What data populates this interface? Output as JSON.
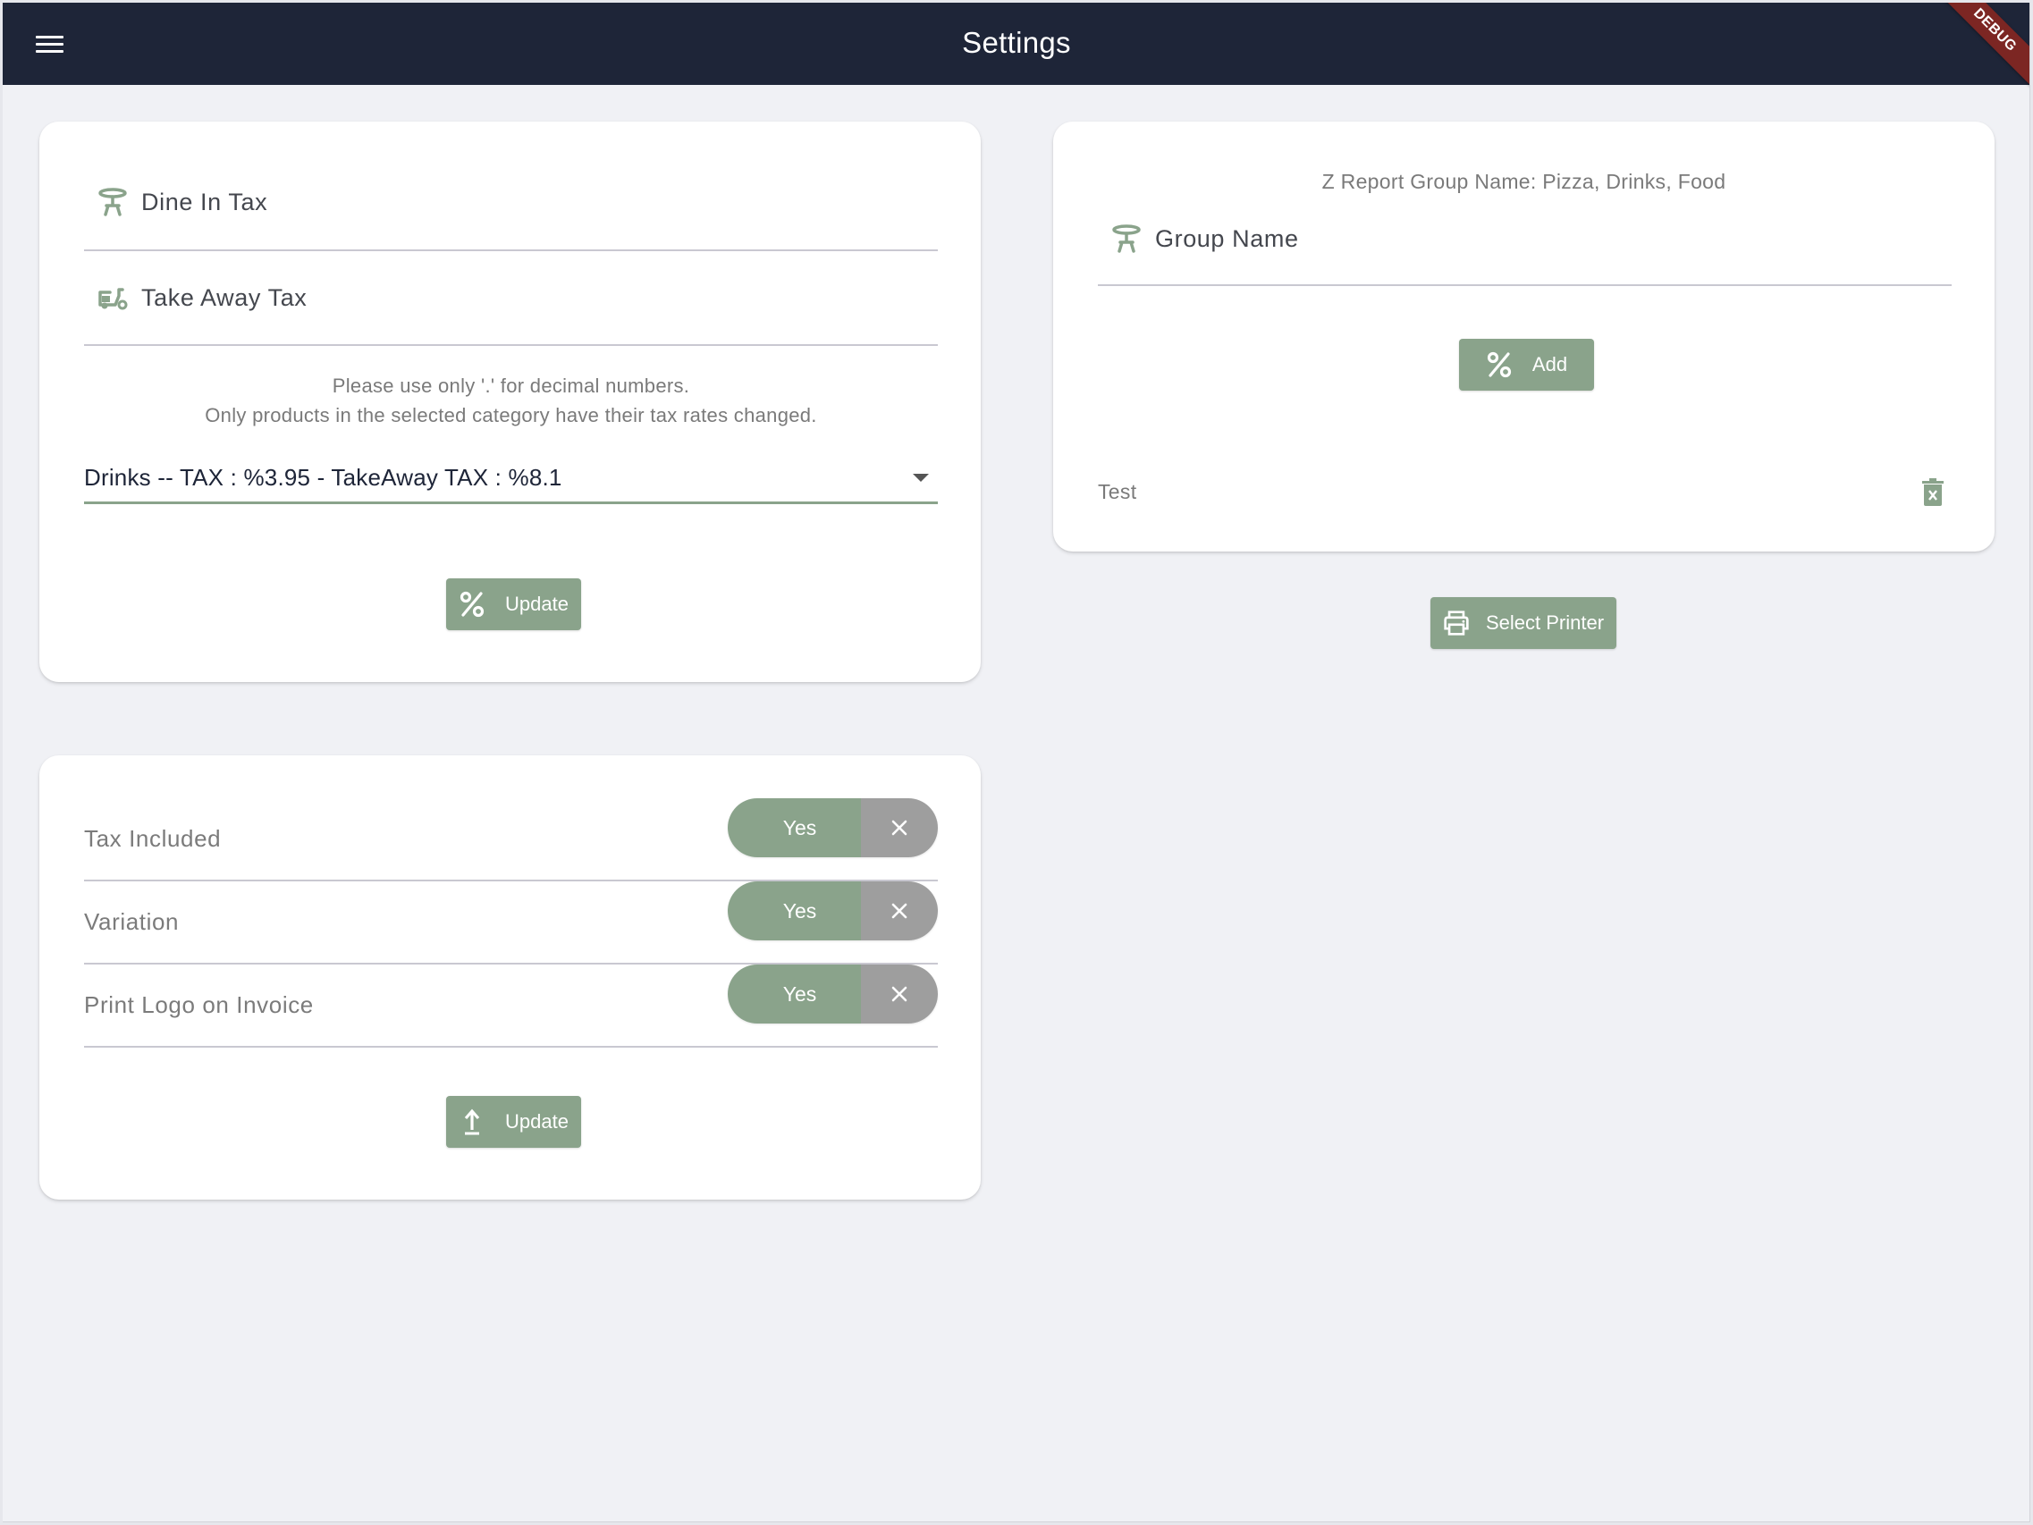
{
  "appbar": {
    "title": "Settings",
    "menu_icon": "hamburger-menu-icon",
    "debug_banner": "DEBUG"
  },
  "colors": {
    "appbar_bg": "#1e2538",
    "accent": "#8aa38b",
    "toggle_off": "#9e9e9e",
    "debug_banner": "#7c2623",
    "page_bg": "#f0f1f5"
  },
  "tax_card": {
    "dine_in": {
      "label": "Dine In Tax",
      "icon": "table-icon"
    },
    "take_away": {
      "label": "Take Away Tax",
      "icon": "scooter-icon"
    },
    "hint_line1": "Please use only '.' for decimal numbers.",
    "hint_line2": "Only products in the selected category have their tax rates changed.",
    "category_select": {
      "selected": "Drinks -- TAX : %3.95 - TakeAway TAX : %8.1"
    },
    "update_button": {
      "label": "Update",
      "icon": "percent-icon"
    }
  },
  "options_card": {
    "rows": [
      {
        "label": "Tax Included",
        "yes_label": "Yes",
        "value": true
      },
      {
        "label": "Variation",
        "yes_label": "Yes",
        "value": true
      },
      {
        "label": "Print Logo on Invoice",
        "yes_label": "Yes",
        "value": true
      }
    ],
    "update_button": {
      "label": "Update",
      "icon": "upload-icon"
    }
  },
  "zreport_card": {
    "title": "Z Report Group Name: Pizza, Drinks, Food",
    "group_name_field": {
      "label": "Group Name",
      "icon": "table-icon"
    },
    "add_button": {
      "label": "Add",
      "icon": "percent-icon"
    },
    "groups": [
      {
        "name": "Test",
        "delete_icon": "delete-forever-icon"
      }
    ]
  },
  "printer_button": {
    "label": "Select Printer",
    "icon": "printer-icon"
  }
}
